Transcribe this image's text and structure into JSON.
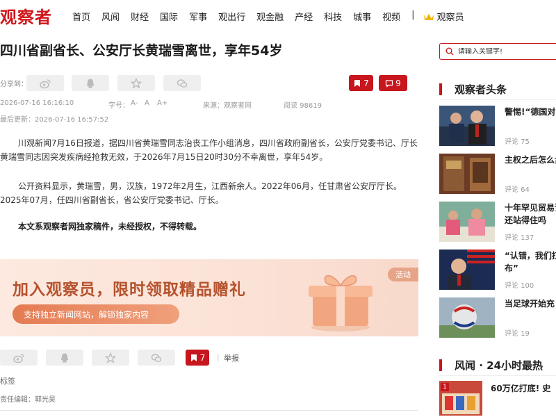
{
  "site": {
    "logo": "观察者"
  },
  "nav": {
    "items": [
      "首页",
      "风闻",
      "财经",
      "国际",
      "军事",
      "观出行",
      "观金融",
      "产经",
      "科技",
      "城事",
      "视频"
    ],
    "separator": "|",
    "member_label": "观察员"
  },
  "article": {
    "title": "四川省副省长、公安厅长黄瑞雪离世，享年54岁",
    "share_label": "分享到：",
    "bookmark_count": "7",
    "comment_count": "9",
    "publish_time": "2026-07-16 16:16:10",
    "font_label": "字号：",
    "font_sizes": [
      "A-",
      "A",
      "A+"
    ],
    "source": "来源：观察者网",
    "reads": "阅读 98619",
    "updated": "最后更新：2026-07-16 16:57:52",
    "paragraphs": [
      "川观新闻7月16日报道，据四川省黄瑞雪同志治丧工作小组消息，四川省政府副省长，公安厅党委书记、厅长黄瑞雪同志因突发疾病经抢救无效，于2026年7月15日20时30分不幸离世，享年54岁。",
      "公开资料显示，黄瑞雪，男，汉族，1972年2月生，江西新余人。2022年06月，任甘肃省公安厅厅长。2025年07月，任四川省副省长，省公安厅党委书记、厅长。",
      "本文系观察者网独家稿件，未经授权，不得转载。"
    ],
    "bottom_bookmark_count": "7",
    "report_label": "举报",
    "tags_label": "标签",
    "editor": "责任编辑：郭光昊"
  },
  "banner": {
    "title": "加入观察员，限时领取精品赠礼",
    "subtitle": "支持独立新闻网站，解锁独家内容",
    "tag": "活动"
  },
  "sidebar": {
    "search_placeholder": "请输入关键字!",
    "headlines_title": "观察者头条",
    "headlines": [
      {
        "title": "警惕!“德国对",
        "comments": "评论 75"
      },
      {
        "title": "主权之后怎么步",
        "comments": "评论 64"
      },
      {
        "title": "十年罕见贸易话还站得住吗",
        "comments": "评论 137"
      },
      {
        "title": "“认错，我们扛布”",
        "comments": "评论 100"
      },
      {
        "title": "当足球开始充",
        "comments": "评论 19"
      }
    ],
    "rank_title": "风闻 · 24小时最热",
    "rank_items": [
      {
        "num": "1",
        "title": "60万亿打底! 史"
      }
    ]
  },
  "colors": {
    "brand_red": "#c7161d",
    "banner_text": "#b5522e"
  },
  "icons": [
    "weibo-icon",
    "qq-icon",
    "qzone-star-icon",
    "wechat-icon",
    "bookmark-icon",
    "comment-icon",
    "search-icon",
    "crown-icon"
  ]
}
